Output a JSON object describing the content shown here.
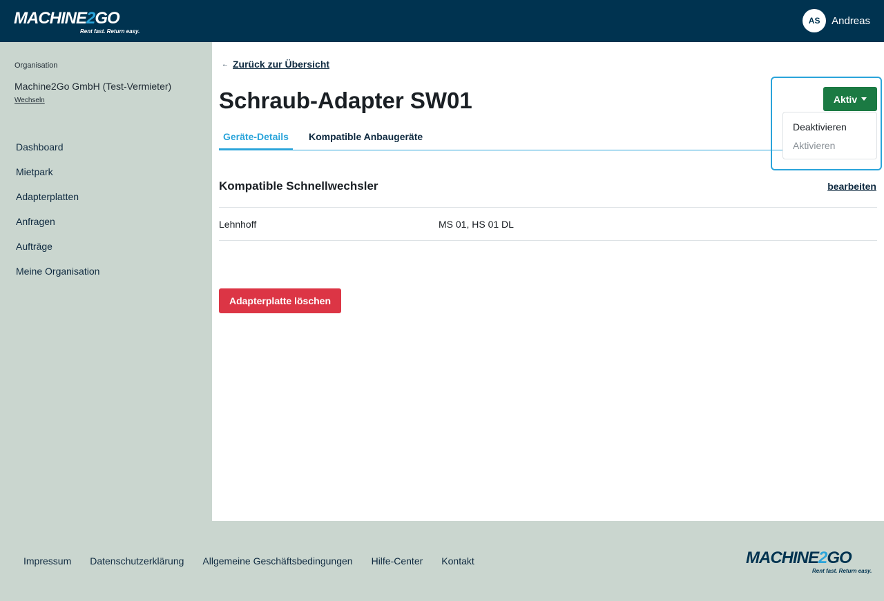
{
  "header": {
    "logo_text_main": "MACHINE",
    "logo_text_two": "2",
    "logo_text_end": "GO",
    "logo_tagline": "Rent fast. Return easy.",
    "user_initials": "AS",
    "user_name": "Andreas"
  },
  "sidebar": {
    "org_label": "Organisation",
    "org_name": "Machine2Go GmbH (Test-Vermieter)",
    "org_switch": "Wechseln",
    "items": [
      {
        "label": "Dashboard"
      },
      {
        "label": "Mietpark"
      },
      {
        "label": "Adapterplatten"
      },
      {
        "label": "Anfragen"
      },
      {
        "label": "Aufträge"
      },
      {
        "label": "Meine Organisation"
      }
    ]
  },
  "main": {
    "back_label": "Zurück zur Übersicht",
    "title": "Schraub-Adapter SW01",
    "tabs": [
      {
        "label": "Geräte-Details",
        "active": true
      },
      {
        "label": "Kompatible Anbaugeräte",
        "active": false
      }
    ],
    "section_title": "Kompatible Schnellwechsler",
    "edit_label": "bearbeiten",
    "rows": [
      {
        "key": "Lehnhoff",
        "value": "MS 01, HS 01 DL"
      }
    ],
    "delete_label": "Adapterplatte löschen"
  },
  "status": {
    "current": "Aktiv",
    "options": [
      {
        "label": "Deaktivieren",
        "enabled": true
      },
      {
        "label": "Aktivieren",
        "enabled": false
      }
    ]
  },
  "footer": {
    "links": [
      "Impressum",
      "Datenschutzerklärung",
      "Allgemeine Geschäftsbedingungen",
      "Hilfe-Center",
      "Kontakt"
    ]
  },
  "colors": {
    "header_bg": "#003350",
    "sidebar_bg": "#cad6cf",
    "accent": "#2aa4da",
    "status_green": "#1b7a43",
    "danger": "#dc3545"
  }
}
